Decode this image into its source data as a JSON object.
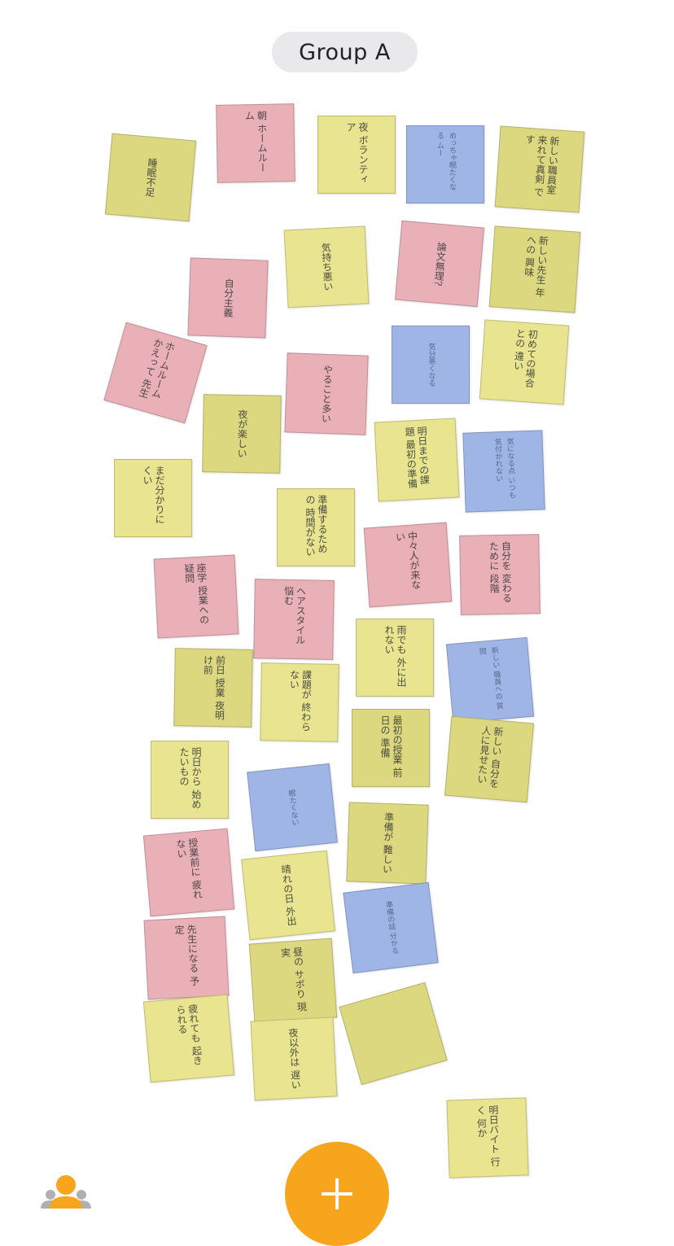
{
  "header": {
    "group_name": "Group A"
  },
  "notes": [
    {
      "color": "olive",
      "text": "睡眠不足"
    },
    {
      "color": "pink",
      "text": "朝 ホームルーム"
    },
    {
      "color": "yellow",
      "text": "夜 ボランティア"
    },
    {
      "color": "blue",
      "text": "めっちゃ眠たくなる ムー"
    },
    {
      "color": "olive",
      "text": "新しい職員室 来れて真剣 です"
    },
    {
      "color": "yellow",
      "text": "気持ち悪い"
    },
    {
      "color": "pink",
      "text": "論文無理?"
    },
    {
      "color": "olive",
      "text": "新しい先生 年への 興味"
    },
    {
      "color": "pink",
      "text": "自分主義"
    },
    {
      "color": "pink",
      "text": "ホームルーム かえって 先生"
    },
    {
      "color": "blue",
      "text": "気分悪くなる"
    },
    {
      "color": "yellow",
      "text": "初めての場合との 違い"
    },
    {
      "color": "pink",
      "text": "やること多い"
    },
    {
      "color": "olive",
      "text": "夜が楽しい"
    },
    {
      "color": "yellow",
      "text": "明日までの課題 最初の準備"
    },
    {
      "color": "blue",
      "text": "気になる点 いつも 気付かれない"
    },
    {
      "color": "yellow",
      "text": "まだ分かりにくい"
    },
    {
      "color": "yellow",
      "text": "準備するための 時間がない"
    },
    {
      "color": "pink",
      "text": "中々人が来ない"
    },
    {
      "color": "pink",
      "text": "自分を 変わる ために 段階"
    },
    {
      "color": "pink",
      "text": "座学 授業への 疑問"
    },
    {
      "color": "pink",
      "text": "ヘアスタイル 悩む"
    },
    {
      "color": "yellow",
      "text": "雨でも 外に出れない"
    },
    {
      "color": "blue",
      "text": "新しい 職員への 質問"
    },
    {
      "color": "olive",
      "text": "前日 授業 夜明け前"
    },
    {
      "color": "yellow",
      "text": "課題が 終わらない"
    },
    {
      "color": "olive",
      "text": "最初の授業 前日の 準備"
    },
    {
      "color": "olive",
      "text": "新しい 自分を 人に見せたい"
    },
    {
      "color": "yellow",
      "text": "明日から 始めたいもの"
    },
    {
      "color": "blue",
      "text": "眠たくない"
    },
    {
      "color": "olive",
      "text": "準備が 難しい"
    },
    {
      "color": "pink",
      "text": "授業前に 疲れない"
    },
    {
      "color": "yellow",
      "text": "晴れの日 外出"
    },
    {
      "color": "blue",
      "text": "準備の話 分かる"
    },
    {
      "color": "pink",
      "text": "先生になる 予定"
    },
    {
      "color": "olive",
      "text": "昼の サボり 現実"
    },
    {
      "color": "yellow",
      "text": "疲れても 起きられる"
    },
    {
      "color": "yellow",
      "text": "夜以外は 遅い"
    },
    {
      "color": "olive",
      "text": ""
    },
    {
      "color": "yellow",
      "text": "明日バイト 行く 何か"
    }
  ],
  "fab": {
    "icon": "plus-icon",
    "color": "#f7a51d"
  },
  "footer": {
    "icon": "people-icon",
    "person_colors": [
      "#f7a51d",
      "#b0b0b0"
    ]
  }
}
